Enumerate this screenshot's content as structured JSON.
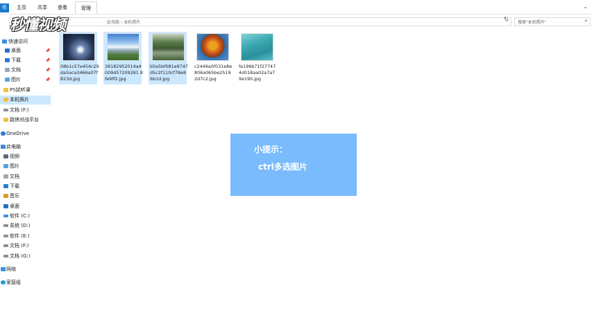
{
  "ribbon": {
    "file_tab": "件",
    "tabs": [
      "主页",
      "共享",
      "查看"
    ],
    "manage_tab": "管理"
  },
  "address": {
    "path_hint": "此电脑 › 本机照片"
  },
  "search": {
    "placeholder": "搜索\"本机照片\""
  },
  "watermark": "秒懂视频",
  "sidebar": {
    "items": [
      {
        "label": "快速访问",
        "icon": "star-icon",
        "pin": false,
        "selected": false
      },
      {
        "label": "桌面",
        "icon": "desktop-icon",
        "pin": true,
        "selected": false
      },
      {
        "label": "下载",
        "icon": "download-icon",
        "pin": true,
        "selected": false
      },
      {
        "label": "文档",
        "icon": "document-icon",
        "pin": true,
        "selected": false
      },
      {
        "label": "图片",
        "icon": "picture-icon",
        "pin": true,
        "selected": false
      },
      {
        "label": "PS試听课",
        "icon": "folder-icon",
        "pin": false,
        "selected": false
      },
      {
        "label": "本机照片",
        "icon": "folder-icon",
        "pin": false,
        "selected": true
      },
      {
        "label": "文档 (F:)",
        "icon": "drive-icon",
        "pin": false,
        "selected": false
      },
      {
        "label": "路侠对战平台",
        "icon": "folder-icon",
        "pin": false,
        "selected": false
      },
      {
        "label": "OneDrive",
        "icon": "cloud-icon",
        "pin": false,
        "selected": false
      },
      {
        "label": "此电脑",
        "icon": "computer-icon",
        "pin": false,
        "selected": false
      },
      {
        "label": "视频",
        "icon": "video-icon",
        "pin": false,
        "selected": false
      },
      {
        "label": "图片",
        "icon": "picture-icon",
        "pin": false,
        "selected": false
      },
      {
        "label": "文档",
        "icon": "document-icon",
        "pin": false,
        "selected": false
      },
      {
        "label": "下载",
        "icon": "download-icon",
        "pin": false,
        "selected": false
      },
      {
        "label": "音乐",
        "icon": "music-icon",
        "pin": false,
        "selected": false
      },
      {
        "label": "桌面",
        "icon": "desktop-icon",
        "pin": false,
        "selected": false
      },
      {
        "label": "软件 (C:)",
        "icon": "drive-icon",
        "pin": false,
        "selected": false
      },
      {
        "label": "系统 (D:)",
        "icon": "drive-icon",
        "pin": false,
        "selected": false
      },
      {
        "label": "软件 (E:)",
        "icon": "drive-icon",
        "pin": false,
        "selected": false
      },
      {
        "label": "文档 (F:)",
        "icon": "drive-icon",
        "pin": false,
        "selected": false
      },
      {
        "label": "文档 (G:)",
        "icon": "drive-icon",
        "pin": false,
        "selected": false
      },
      {
        "label": "网络",
        "icon": "network-icon",
        "pin": false,
        "selected": false
      },
      {
        "label": "家庭组",
        "icon": "homegroup-icon",
        "pin": false,
        "selected": false
      }
    ]
  },
  "files": [
    {
      "name": "08b1c57e454c29da5aca3466a07f823d.jpg",
      "selected": true,
      "thumb": "night-sky"
    },
    {
      "name": "36182952014a4009d57209281 8fe9ff2.jpg",
      "selected": true,
      "thumb": "mountain"
    },
    {
      "name": "b5e5bf081e9747d5c2f110cf78e86b1d.jpg",
      "selected": true,
      "thumb": "lake"
    },
    {
      "name": "c2449a0f031e8e806a065be25192d7c2.jpg",
      "selected": false,
      "thumb": "autumn-tree"
    },
    {
      "name": "fe196b71f277474d018aa02a7a79e190.jpg",
      "selected": false,
      "thumb": "water"
    }
  ],
  "tip": {
    "title": "小提示：",
    "body": "ctrl多选图片"
  },
  "colors": {
    "selection": "#cce8ff",
    "tip_background": "#79bbfc",
    "file_tab": "#1979ca"
  }
}
